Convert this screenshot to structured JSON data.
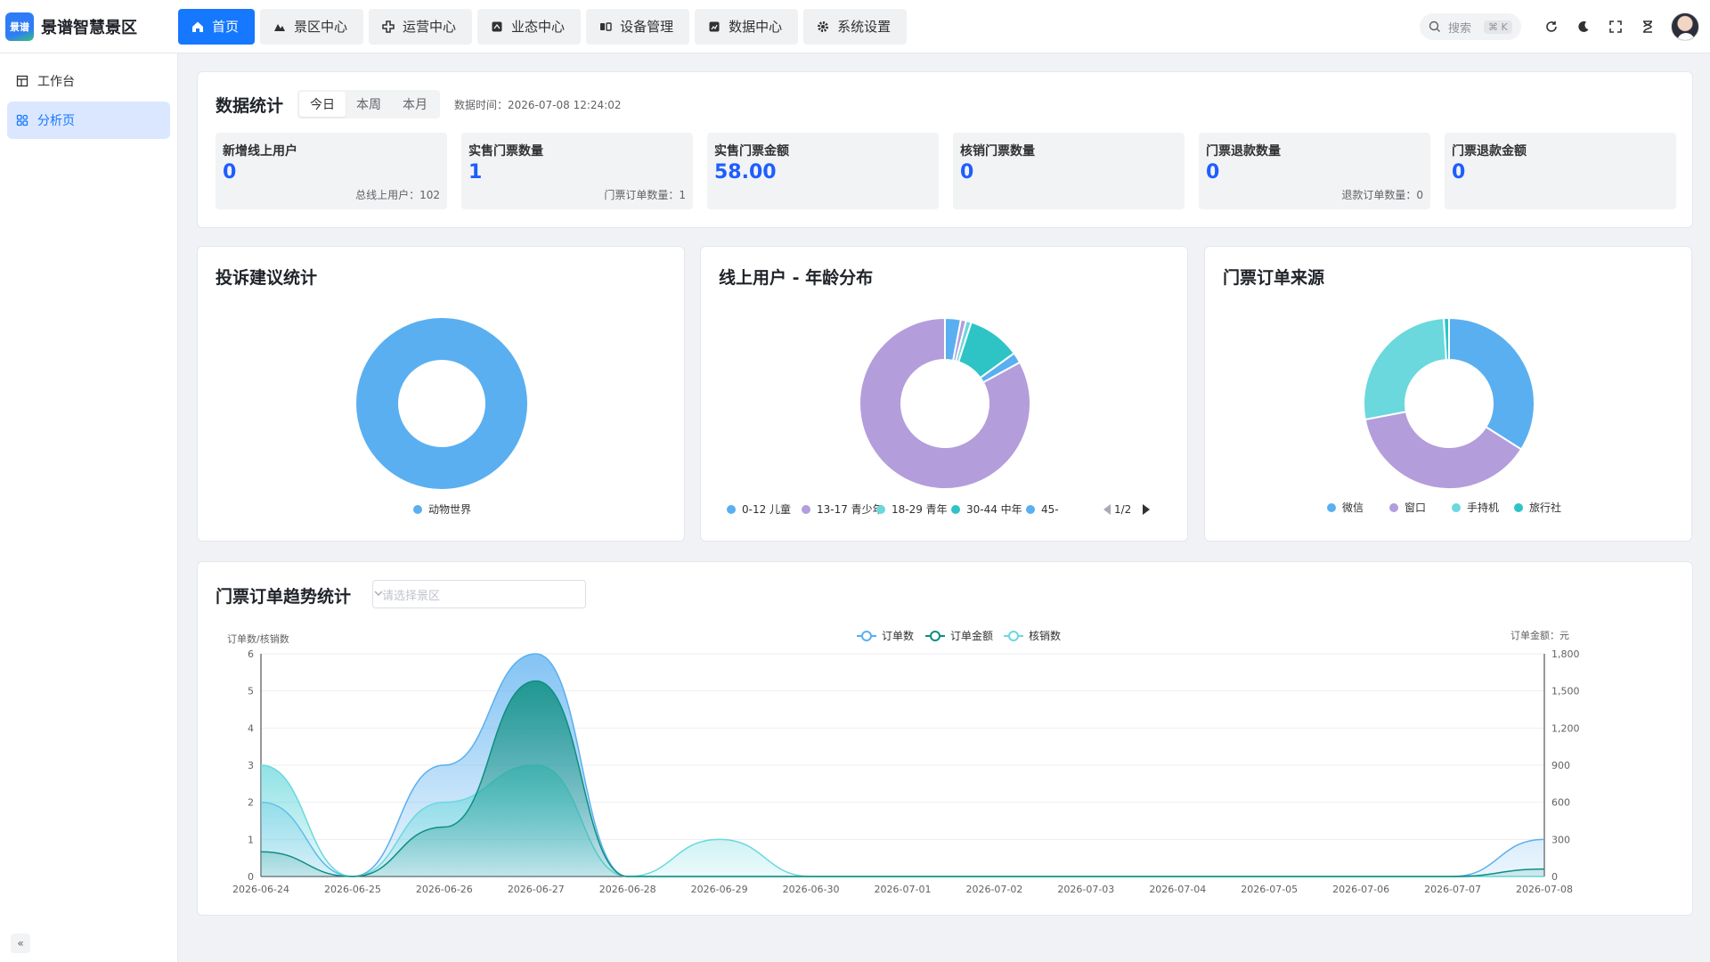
{
  "app": {
    "logo_text": "景谱",
    "title": "景谱智慧景区"
  },
  "nav": [
    {
      "label": "首页",
      "icon": "home-icon",
      "active": true
    },
    {
      "label": "景区中心",
      "icon": "mountain-icon",
      "active": false
    },
    {
      "label": "运营中心",
      "icon": "operations-icon",
      "active": false
    },
    {
      "label": "业态中心",
      "icon": "business-icon",
      "active": false
    },
    {
      "label": "设备管理",
      "icon": "device-icon",
      "active": false
    },
    {
      "label": "数据中心",
      "icon": "data-icon",
      "active": false
    },
    {
      "label": "系统设置",
      "icon": "gear-icon",
      "active": false
    }
  ],
  "header": {
    "search_placeholder": "搜索",
    "search_shortcut": "⌘ K"
  },
  "sidebar": {
    "items": [
      {
        "label": "工作台",
        "icon": "workbench-icon",
        "active": false
      },
      {
        "label": "分析页",
        "icon": "analysis-icon",
        "active": true
      }
    ],
    "collapse": "«"
  },
  "stats": {
    "title": "数据统计",
    "tabs": [
      "今日",
      "本周",
      "本月"
    ],
    "active_tab": "今日",
    "data_time": "数据时间：2026-07-08 12:24:02",
    "items": [
      {
        "label": "新增线上用户",
        "value": "0",
        "sub": "总线上用户：102"
      },
      {
        "label": "实售门票数量",
        "value": "1",
        "sub": "门票订单数量：1"
      },
      {
        "label": "实售门票金额",
        "value": "58.00",
        "sub": ""
      },
      {
        "label": "核销门票数量",
        "value": "0",
        "sub": ""
      },
      {
        "label": "门票退款数量",
        "value": "0",
        "sub": "退款订单数量：0"
      },
      {
        "label": "门票退款金额",
        "value": "0",
        "sub": ""
      }
    ]
  },
  "pies": [
    {
      "title": "投诉建议统计",
      "legend": [
        "动物世界"
      ],
      "slices": [
        {
          "name": "动物世界",
          "value": 100,
          "color": "#5aaff0"
        }
      ]
    },
    {
      "title": "线上用户 - 年龄分布",
      "legend": [
        "0-12 儿童",
        "13-17 青少年",
        "18-29 青年",
        "30-44 中年",
        "45-"
      ],
      "pager": "1/2",
      "slices": [
        {
          "name": "0-12 儿童",
          "value": 3,
          "color": "#5aaff0"
        },
        {
          "name": "13-17 青少年",
          "value": 1,
          "color": "#b39ddb"
        },
        {
          "name": "18-29 青年",
          "value": 1,
          "color": "#6ad8dd"
        },
        {
          "name": "30-44 中年",
          "value": 10,
          "color": "#2ec4c6"
        },
        {
          "name": "45-",
          "value": 2,
          "color": "#5aaff0"
        },
        {
          "name": "",
          "value": 83,
          "color": "#b39ddb"
        }
      ]
    },
    {
      "title": "门票订单来源",
      "legend": [
        "微信",
        "窗口",
        "手持机",
        "旅行社"
      ],
      "slices": [
        {
          "name": "微信",
          "value": 34,
          "color": "#5aaff0"
        },
        {
          "name": "窗口",
          "value": 38,
          "color": "#b39ddb"
        },
        {
          "name": "手持机",
          "value": 27,
          "color": "#6ad8dd"
        },
        {
          "name": "旅行社",
          "value": 1,
          "color": "#2ec4c6"
        }
      ]
    }
  ],
  "trend": {
    "title": "门票订单趋势统计",
    "select_placeholder": "请选择景区"
  },
  "chart_data": {
    "type": "area",
    "title": "门票订单趋势统计",
    "ylabel": "订单数/核销数",
    "y2label": "订单金额：元",
    "ylim": [
      0,
      6
    ],
    "y2lim": [
      0,
      1800
    ],
    "yticks": [
      0,
      1,
      2,
      3,
      4,
      5,
      6
    ],
    "y2ticks": [
      0,
      300,
      600,
      900,
      1200,
      1500,
      1800
    ],
    "categories": [
      "2026-06-24",
      "2026-06-25",
      "2026-06-26",
      "2026-06-27",
      "2026-06-28",
      "2026-06-29",
      "2026-06-30",
      "2026-07-01",
      "2026-07-02",
      "2026-07-03",
      "2026-07-04",
      "2026-07-05",
      "2026-07-06",
      "2026-07-07",
      "2026-07-08"
    ],
    "series": [
      {
        "name": "订单数",
        "axis": "left",
        "color": "#5aaff0",
        "values": [
          2,
          0,
          3,
          6,
          0,
          0,
          0,
          0,
          0,
          0,
          0,
          0,
          0,
          0,
          1
        ]
      },
      {
        "name": "订单金额",
        "axis": "right",
        "color": "#0d8f7f",
        "values": [
          200,
          0,
          400,
          1580,
          0,
          0,
          0,
          0,
          0,
          0,
          0,
          0,
          0,
          0,
          60
        ]
      },
      {
        "name": "核销数",
        "axis": "left",
        "color": "#6ad8dd",
        "values": [
          3,
          0,
          2,
          3,
          0,
          1,
          0,
          0,
          0,
          0,
          0,
          0,
          0,
          0,
          0
        ]
      }
    ],
    "legend_position": "top"
  }
}
